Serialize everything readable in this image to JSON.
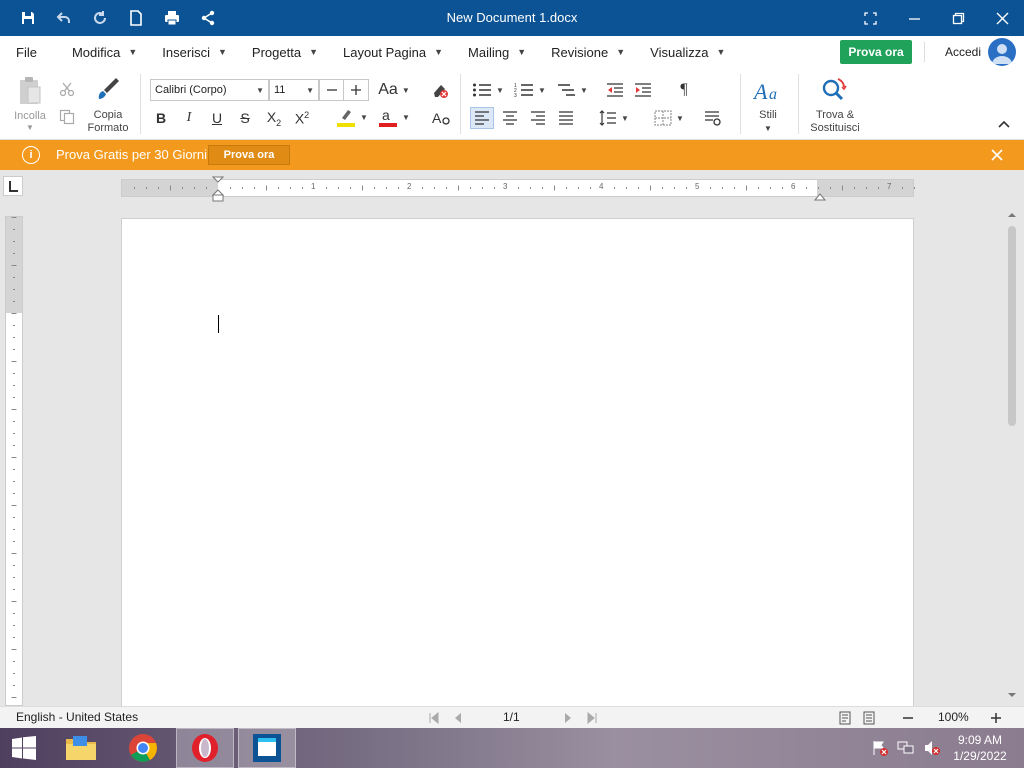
{
  "titlebar": {
    "title": "New Document 1.docx"
  },
  "menu": {
    "items": [
      {
        "label": "File",
        "has_caret": false
      },
      {
        "label": "Modifica",
        "has_caret": true
      },
      {
        "label": "Inserisci",
        "has_caret": true
      },
      {
        "label": "Progetta",
        "has_caret": true
      },
      {
        "label": "Layout Pagina",
        "has_caret": true
      },
      {
        "label": "Mailing",
        "has_caret": true
      },
      {
        "label": "Revisione",
        "has_caret": true
      },
      {
        "label": "Visualizza",
        "has_caret": true
      }
    ],
    "cta_label": "Prova ora",
    "accedi_label": "Accedi"
  },
  "ribbon": {
    "paste_label": "Incolla",
    "format_painter_label_1": "Copia",
    "format_painter_label_2": "Formato",
    "font_name": "Calibri (Corpo)",
    "font_size": "11",
    "case_label": "Aa",
    "styles_label": "Stili",
    "find_label_1": "Trova &",
    "find_label_2": "Sostituisci",
    "bold": "B",
    "italic": "I",
    "underline": "U",
    "strike": "S",
    "pilcrow": "¶",
    "highlight_color": "#f0e000",
    "font_color": "#e02020"
  },
  "notification": {
    "message": "Prova Gratis per 30 Giorni",
    "button_label": "Prova ora"
  },
  "ruler": {
    "numbers": [
      "1",
      "2",
      "3",
      "4",
      "5",
      "6",
      "7"
    ]
  },
  "statusbar": {
    "language": "English - United States",
    "page": "1/1",
    "zoom": "100%"
  },
  "taskbar": {
    "time": "9:09 AM",
    "date": "1/29/2022"
  },
  "colors": {
    "titlebar": "#0b5394",
    "accent_green": "#20a25b",
    "notification": "#f39a1e"
  }
}
